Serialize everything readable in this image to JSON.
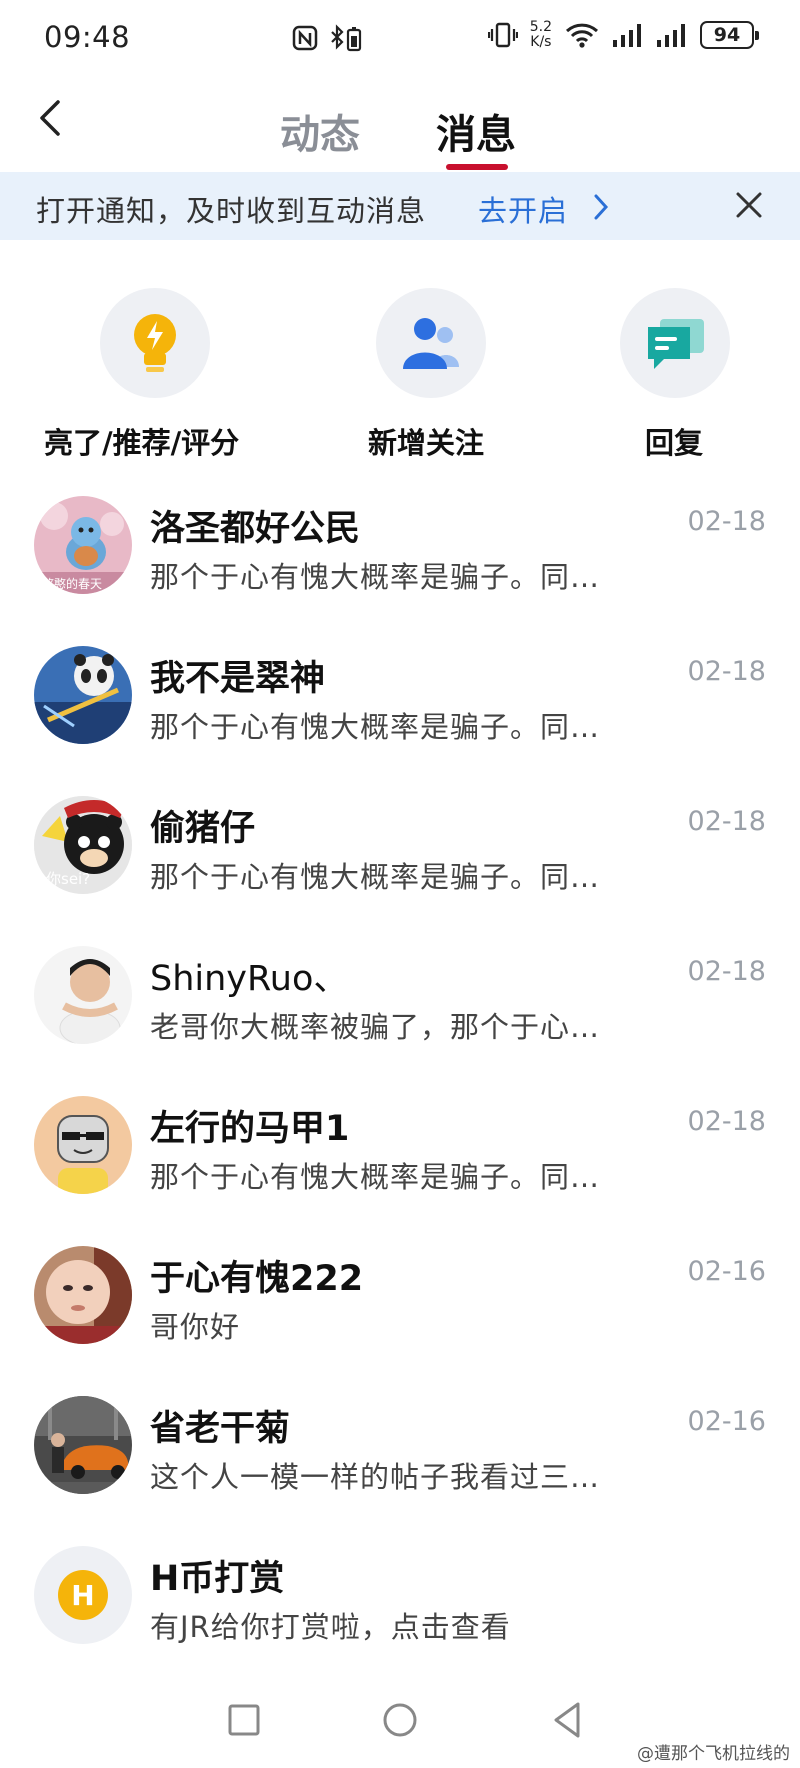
{
  "status_bar": {
    "time": "09:48",
    "speed_top": "5.2",
    "speed_bottom": "K/s",
    "battery": "94"
  },
  "header": {
    "tabs": [
      {
        "label": "动态",
        "active": false
      },
      {
        "label": "消息",
        "active": true
      }
    ],
    "accent_color": "#c8102e"
  },
  "banner": {
    "text": "打开通知，及时收到互动消息",
    "link": "去开启"
  },
  "shortcuts": [
    {
      "label": "亮了/推荐/评分",
      "icon": "lightbulb-icon",
      "color": "#f5b40a"
    },
    {
      "label": "新增关注",
      "icon": "new-follower-icon",
      "color": "#2d6fe0"
    },
    {
      "label": "回复",
      "icon": "reply-bubble-icon",
      "color": "#18a8a0"
    }
  ],
  "messages": [
    {
      "name": "洛圣都好公民",
      "preview": "那个于心有愧大概率是骗子。同…",
      "date": "02-18",
      "avatar_text": "憨憨的春天"
    },
    {
      "name": "我不是翠神",
      "preview": "那个于心有愧大概率是骗子。同…",
      "date": "02-18"
    },
    {
      "name": "偷猪仔",
      "preview": "那个于心有愧大概率是骗子。同…",
      "date": "02-18",
      "avatar_text": "你sei?"
    },
    {
      "name": "ShinyRuo、",
      "preview": "老哥你大概率被骗了，那个于心…",
      "date": "02-18"
    },
    {
      "name": "左行的马甲1",
      "preview": "那个于心有愧大概率是骗子。同…",
      "date": "02-18"
    },
    {
      "name": "于心有愧222",
      "preview": "哥你好",
      "date": "02-16"
    },
    {
      "name": "省老干菊",
      "preview": "这个人一模一样的帖子我看过三…",
      "date": "02-16"
    },
    {
      "name": "H币打赏",
      "preview": "有JR给你打赏啦，点击查看",
      "date": "",
      "avatar_text": "H"
    }
  ],
  "watermark": "@遭那个飞机拉线的"
}
